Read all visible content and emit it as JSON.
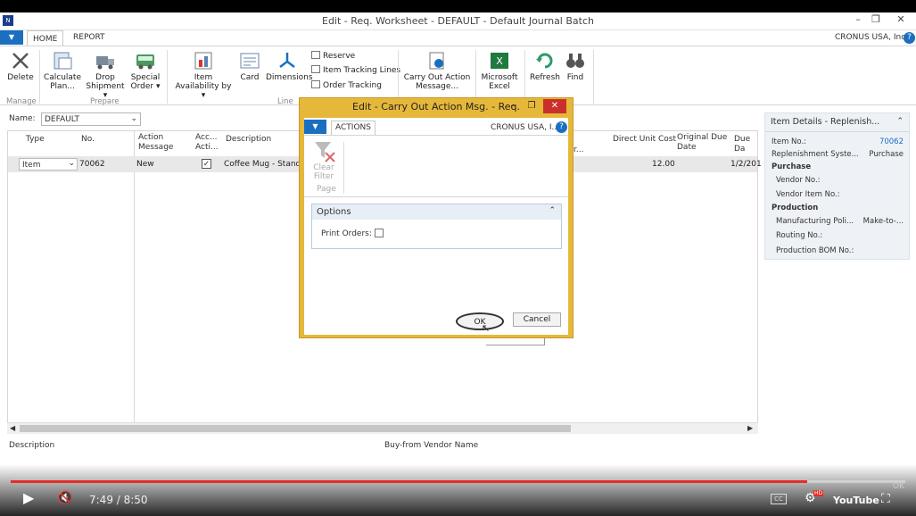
{
  "window": {
    "title": "Edit - Req. Worksheet - DEFAULT - Default Journal Batch",
    "min": "–",
    "restore": "❐",
    "close": "✕"
  },
  "tabs": {
    "home": "HOME",
    "report": "REPORT",
    "company": "CRONUS USA, Inc.",
    "help": "?"
  },
  "ribbon": {
    "delete": "Delete",
    "calc1": "Calculate",
    "calc2": "Plan...",
    "drop1": "Drop",
    "drop2": "Shipment ▾",
    "special1": "Special",
    "special2": "Order ▾",
    "itemavail1": "Item",
    "itemavail2": "Availability by ▾",
    "card": "Card",
    "dimensions": "Dimensions",
    "reserve": "Reserve",
    "tracking": "Item Tracking Lines",
    "ordertracking": "Order Tracking",
    "carry1": "Carry Out Action",
    "carry2": "Message...",
    "excel1": "Microsoft",
    "excel2": "Excel",
    "refresh": "Refresh",
    "find": "Find",
    "g_manage": "Manage",
    "g_prepare": "Prepare",
    "g_line": "Line"
  },
  "name_field": {
    "label": "Name:",
    "value": "DEFAULT"
  },
  "grid": {
    "headers": {
      "type": "Type",
      "no": "No.",
      "action1": "Action",
      "action2": "Message",
      "acc1": "Acc...",
      "acc2": "Acti...",
      "desc": "Description",
      "ddu": "Direct Unit Cost",
      "odd1": "Original Due",
      "odd2": "Date",
      "due": "Due Da",
      "r": "r..."
    },
    "row": {
      "type": "Item",
      "no": "70062",
      "action": "New",
      "check": "✓",
      "desc": "Coffee Mug - Standar",
      "cost": "12.00",
      "due": "1/2/201"
    }
  },
  "status": {
    "description": "Description",
    "vendor": "Buy-from Vendor Name"
  },
  "factbox": {
    "title": "Item Details - Replenish...",
    "item_no_label": "Item No.:",
    "item_no": "70062",
    "repl_label": "Replenishment Syste...",
    "repl": "Purchase",
    "purchase": "Purchase",
    "vendor_no": "Vendor No.:",
    "vendor_item": "Vendor Item No.:",
    "production": "Production",
    "mfg_label": "Manufacturing Poli...",
    "mfg": "Make-to-...",
    "routing": "Routing No.:",
    "bom": "Production BOM No.:"
  },
  "dialog": {
    "title": "Edit - Carry Out Action Msg. - Req.",
    "tab_actions": "ACTIONS",
    "company": "CRONUS USA, I...",
    "clear1": "Clear",
    "clear2": "Filter",
    "page": "Page",
    "options": "Options",
    "print_orders": "Print Orders:",
    "ok": "OK",
    "cancel": "Cancel"
  },
  "youtube": {
    "time": "7:49 / 8:50",
    "progress": 0.89,
    "ok": "OK",
    "brand": "YouTube",
    "hd": "HD",
    "cc": "CC"
  },
  "colors": {
    "accent": "#1a6fc1",
    "dialog_frame": "#e6b83a",
    "progress": "#e52d27"
  }
}
